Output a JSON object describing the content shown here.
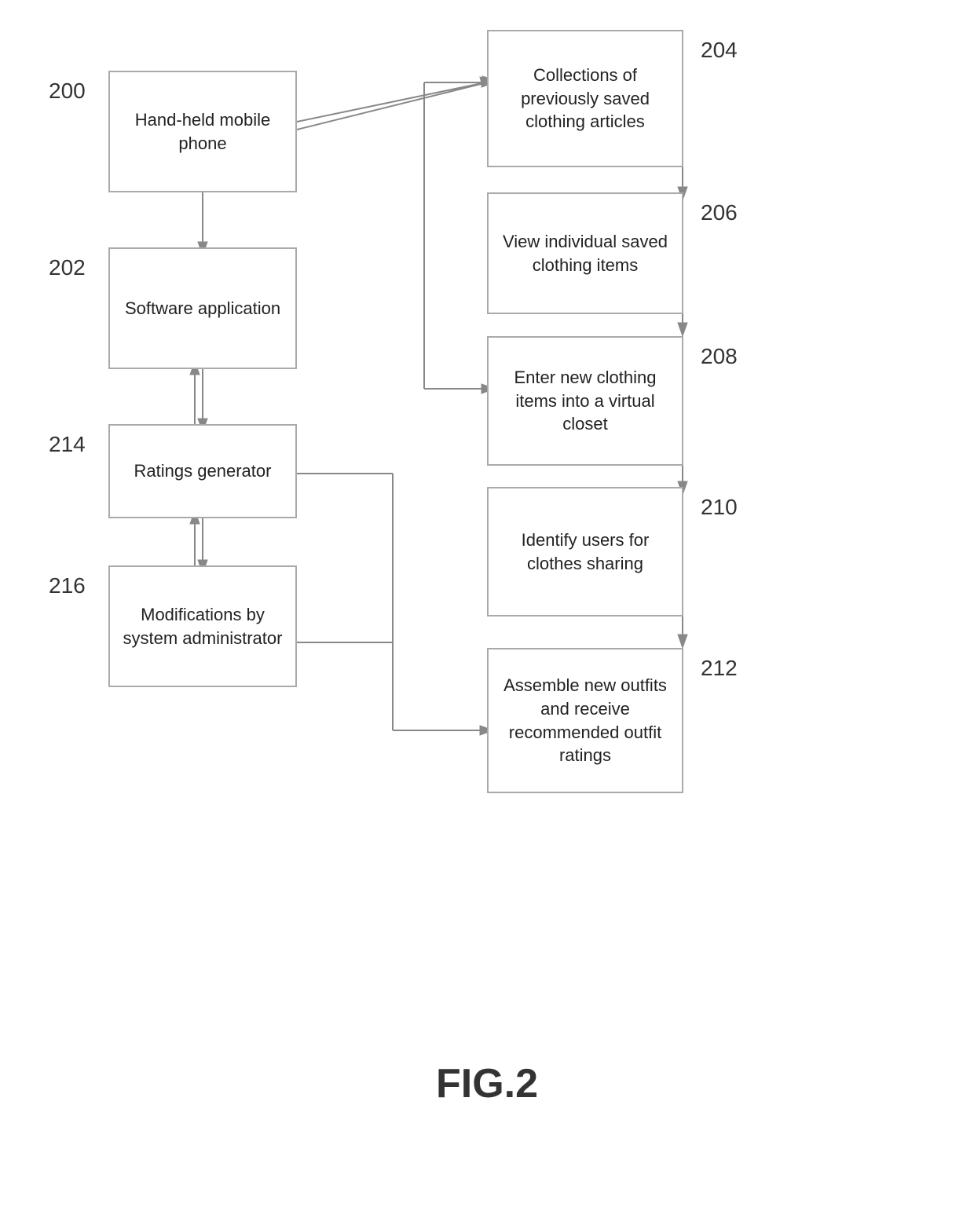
{
  "figure": {
    "label": "FIG.2"
  },
  "nodes": {
    "n200_label": "200",
    "n202_label": "202",
    "n204_label": "204",
    "n206_label": "206",
    "n208_label": "208",
    "n210_label": "210",
    "n212_label": "212",
    "n214_label": "214",
    "n216_label": "216",
    "n200_text": "Hand-held mobile phone",
    "n202_text": "Software application",
    "n204_text": "Collections of previously saved clothing articles",
    "n206_text": "View individual saved clothing items",
    "n208_text": "Enter new clothing items into a virtual closet",
    "n210_text": "Identify users for clothes sharing",
    "n212_text": "Assemble new outfits and receive recommended outfit ratings",
    "n214_text": "Ratings generator",
    "n216_text": "Modifications by system administrator"
  }
}
